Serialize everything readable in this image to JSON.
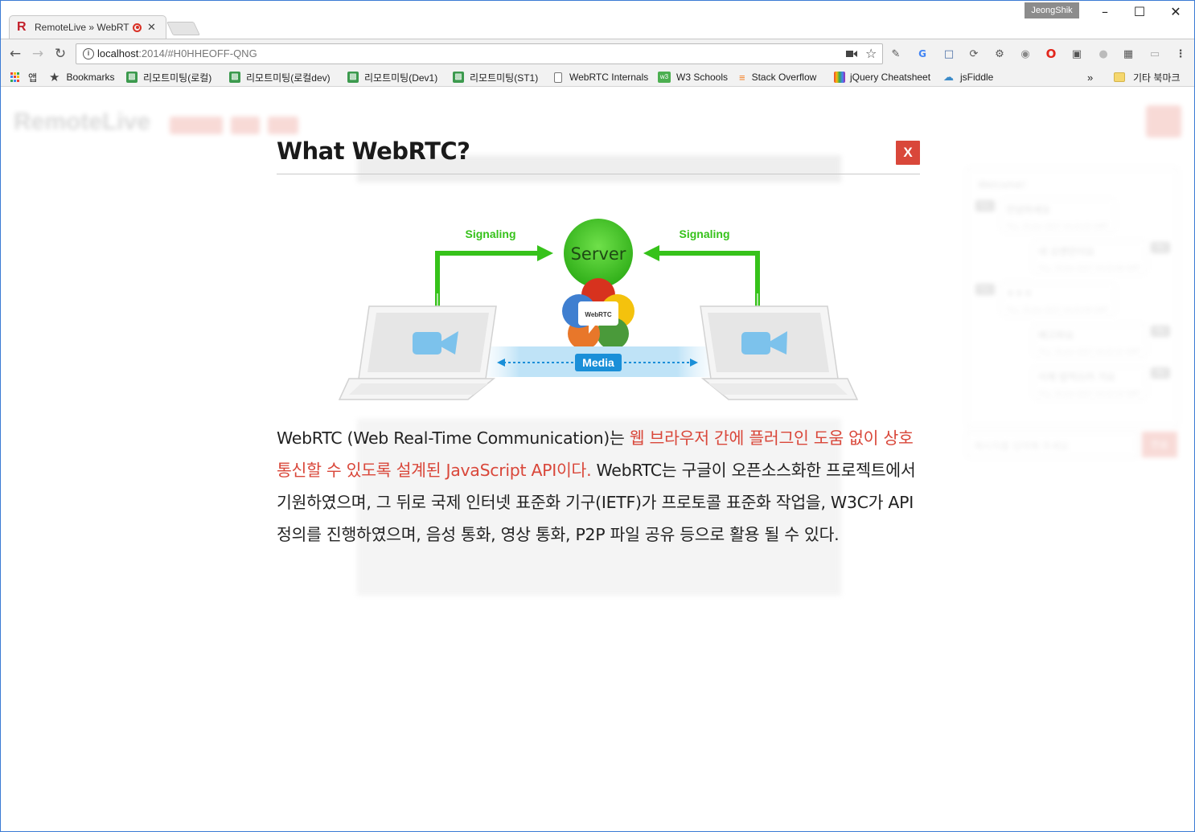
{
  "browser": {
    "tab_title": "RemoteLive » WebRTC",
    "tab_close": "✕",
    "profile_name": "JeongShik",
    "url_host": "localhost",
    "url_rest": ":2014/#H0HHEOFF-QNG",
    "bookmarks": [
      {
        "label": "앱",
        "icon": "apps-icon"
      },
      {
        "label": "Bookmarks",
        "icon": "star-icon"
      },
      {
        "label": "리모트미팅(로컬)",
        "icon": "chat-icon"
      },
      {
        "label": "리모트미팅(로컬dev)",
        "icon": "chat-icon"
      },
      {
        "label": "리모트미팅(Dev1)",
        "icon": "chat-icon"
      },
      {
        "label": "리모트미팅(ST1)",
        "icon": "chat-icon"
      },
      {
        "label": "WebRTC Internals",
        "icon": "page-icon"
      },
      {
        "label": "W3 Schools",
        "icon": "w3-icon"
      },
      {
        "label": "Stack Overflow",
        "icon": "stackoverflow-icon"
      },
      {
        "label": "jQuery Cheatsheet",
        "icon": "jquery-icon"
      },
      {
        "label": "jsFiddle",
        "icon": "jsfiddle-icon"
      }
    ],
    "overflow": "»",
    "other_bookmarks": "기타 북마크"
  },
  "background": {
    "logo": "RemoteLive",
    "chat_welcome": "Welcome!",
    "chat_messages": [
      {
        "who": "You",
        "text": "안녕하세요",
        "time": "Thu, 15 Jun 2017 14:22:01 GMT",
        "side": "left"
      },
      {
        "who": "Me",
        "text": "네 오랜만이요",
        "time": "Thu, 15 Jun 2017 14:22:06 GMT",
        "side": "right"
      },
      {
        "who": "You",
        "text": "ㅎㅎㅎ",
        "time": "Thu, 15 Jun 2017 14:22:09 GMT",
        "side": "left"
      },
      {
        "who": "Me",
        "text": "배고파요",
        "time": "Thu, 15 Jun 2017 14:22:21 GMT",
        "side": "right"
      },
      {
        "who": "Me",
        "text": "이제 밥먹으러 가요",
        "time": "Thu, 15 Jun 2017 14:22:23 GMT",
        "side": "right"
      }
    ],
    "chat_placeholder": "메시지를 입력해 주세요",
    "chat_send": "전송"
  },
  "modal": {
    "title": "What WebRTC?",
    "close_label": "X",
    "diagram": {
      "server_label": "Server",
      "signaling_left": "Signaling",
      "signaling_right": "Signaling",
      "webrtc_logo": "WebRTC",
      "media_label": "Media"
    },
    "text_plain_1": "WebRTC (Web Real-Time Communication)는 ",
    "text_highlight": "웹 브라우저 간에 플러그인 도움 없이 상호 통신할 수 있도록 설계된 JavaScript API이다.",
    "text_plain_2": " WebRTC는 구글이 오픈소스화한 프로젝트에서 기원하였으며, 그 뒤로 국제 인터넷 표준화 기구(IETF)가 프로토콜 표준화 작업을, W3C가 API 정의를 진행하였으며, 음성 통화, 영상 통화, P2P 파일 공유 등으로 활용 될 수 있다."
  },
  "colors": {
    "accent_red": "#d9473a",
    "signal_green": "#36c21a",
    "media_blue": "#1a8fd8",
    "camera_blue": "#7cc2ec"
  }
}
